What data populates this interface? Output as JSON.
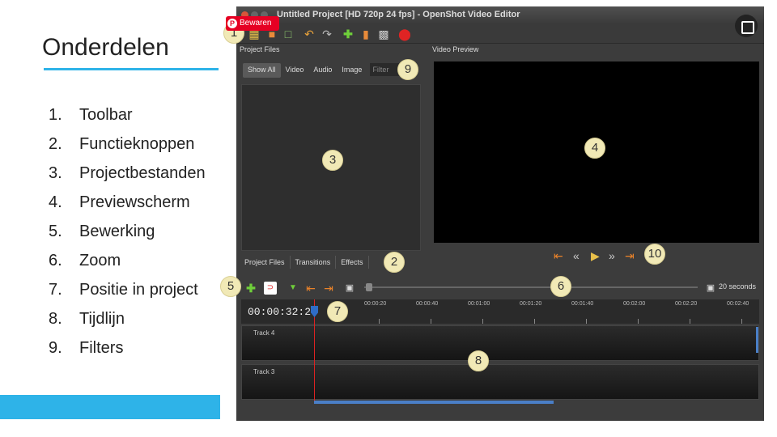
{
  "slide": {
    "title": "Onderdelen",
    "accent_color": "#2eb3e8",
    "items": [
      {
        "num": "1.",
        "label": "Toolbar"
      },
      {
        "num": "2.",
        "label": "Functieknoppen"
      },
      {
        "num": "3.",
        "label": "Projectbestanden"
      },
      {
        "num": "4.",
        "label": "Previewscherm"
      },
      {
        "num": "5.",
        "label": "Bewerking"
      },
      {
        "num": "6.",
        "label": "Zoom"
      },
      {
        "num": "7.",
        "label": "Positie in project"
      },
      {
        "num": "8.",
        "label": "Tijdlijn"
      },
      {
        "num": "9.",
        "label": "Filters"
      }
    ]
  },
  "pinterest": {
    "label": "Bewaren",
    "logo": "P"
  },
  "editor": {
    "window_title": "Untitled Project [HD 720p 24 fps] - OpenShot Video Editor",
    "project_files_header": "Project Files",
    "video_preview_header": "Video Preview",
    "filter_tabs": [
      "Show All",
      "Video",
      "Audio",
      "Image"
    ],
    "filter_placeholder": "Filter",
    "bottom_tabs": [
      "Project Files",
      "Transitions",
      "Effects"
    ],
    "zoom_label": "20 seconds",
    "timecode": "00:00:32:20",
    "ruler": [
      "00:00:20",
      "00:00:40",
      "00:01:00",
      "00:01:20",
      "00:01:40",
      "00:02:00",
      "00:02:20",
      "00:02:40"
    ],
    "tracks": [
      "Track 4",
      "Track 3"
    ]
  },
  "callouts": [
    "1",
    "2",
    "3",
    "4",
    "5",
    "6",
    "7",
    "8",
    "9",
    "10"
  ]
}
